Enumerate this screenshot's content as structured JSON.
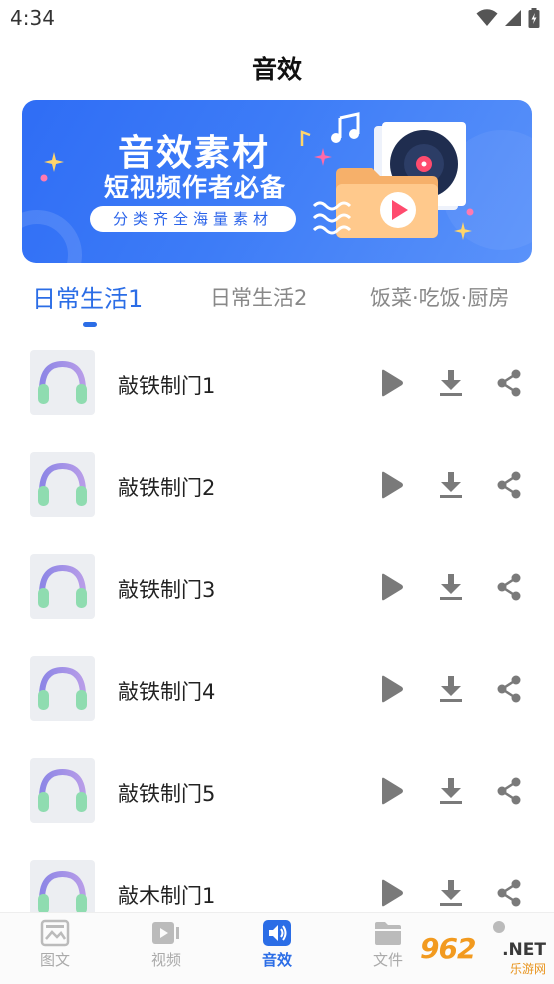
{
  "status_bar": {
    "time": "4:34"
  },
  "page": {
    "title": "音效"
  },
  "banner": {
    "title": "音效素材",
    "subtitle": "短视频作者必备",
    "pill": "分类齐全海量素材"
  },
  "tabs": [
    {
      "label": "日常生活1",
      "active": true
    },
    {
      "label": "日常生活2",
      "active": false
    },
    {
      "label": "饭菜·吃饭·厨房",
      "active": false
    }
  ],
  "items": [
    {
      "name": "敲铁制门1"
    },
    {
      "name": "敲铁制门2"
    },
    {
      "name": "敲铁制门3"
    },
    {
      "name": "敲铁制门4"
    },
    {
      "name": "敲铁制门5"
    },
    {
      "name": "敲木制门1"
    }
  ],
  "item_actions": {
    "play_icon": "play-icon",
    "download_icon": "download-icon",
    "share_icon": "share-icon"
  },
  "bottom_nav": [
    {
      "label": "图文",
      "icon": "image-text-icon",
      "active": false
    },
    {
      "label": "视频",
      "icon": "video-icon",
      "active": false
    },
    {
      "label": "音效",
      "icon": "speaker-icon",
      "active": true
    },
    {
      "label": "文件",
      "icon": "folder-icon",
      "active": false
    },
    {
      "label": "",
      "icon": "profile-icon",
      "active": false
    }
  ],
  "watermark": {
    "brand": "962",
    "suffix": ".NET",
    "sub": "乐游网"
  },
  "colors": {
    "accent": "#2b6de6",
    "banner": "#3d7cf7",
    "icon_gray": "#7a7a7a"
  }
}
